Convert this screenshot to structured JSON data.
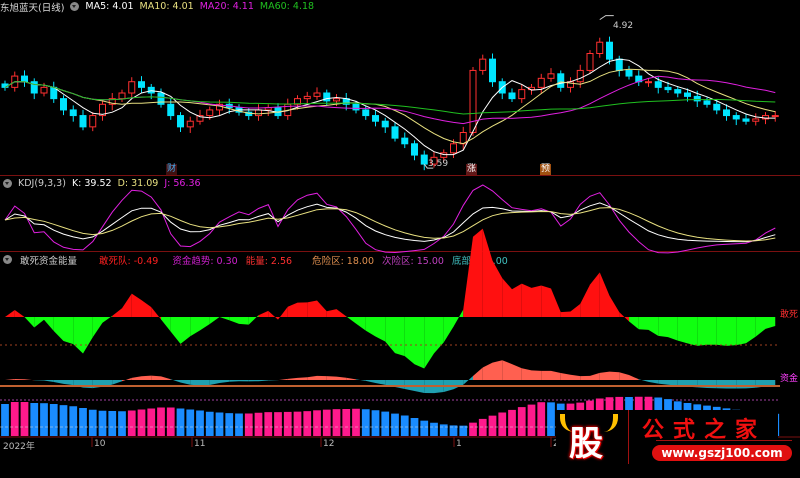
{
  "price_header": {
    "title": "东旭蓝天(日线)",
    "ma5": "MA5: 4.01",
    "ma10": "MA10: 4.01",
    "ma20": "MA20: 4.11",
    "ma60": "MA60: 4.18"
  },
  "kdj_header": {
    "title": "KDJ(9,3,3)",
    "k": "K: 39.52",
    "d": "D: 31.09",
    "j": "J: 56.36"
  },
  "gansi_header": {
    "title": "敢死资金能量",
    "gansi": "敢死队: -0.49",
    "trend": "资金趋势: 0.30",
    "energy": "能量: 2.56",
    "danger": "危险区: 18.00",
    "next_danger": "次险区: 15.00",
    "bottom": "底部区: 2.00"
  },
  "right_labels": {
    "gansi": "敢死",
    "fund": "资金"
  },
  "markers": {
    "high": "4.92",
    "low": "3.59",
    "cai": "财",
    "zhang": "涨",
    "yu": "预"
  },
  "x_axis": [
    "2022年",
    "10",
    "11",
    "12",
    "1",
    "2"
  ],
  "logo": {
    "char": "股",
    "name": "公式之家",
    "url": "www.gszj100.com"
  },
  "colors": {
    "up": "#ff3030",
    "down": "#00e5ff",
    "ma5": "#ffffff",
    "ma10": "#e8e080",
    "ma20": "#e020e0",
    "ma60": "#20c020",
    "gansi_pos": "#ff1010",
    "gansi_neg": "#10ff10",
    "hist_up": "#ff1a8c",
    "hist_down": "#1a8cff"
  },
  "chart_data": {
    "type": "candlestick",
    "ylim": [
      3.55,
      4.95
    ],
    "closes": [
      4.3,
      4.4,
      4.35,
      4.25,
      4.3,
      4.2,
      4.1,
      4.05,
      3.95,
      4.05,
      4.15,
      4.2,
      4.25,
      4.35,
      4.3,
      4.25,
      4.15,
      4.05,
      3.95,
      4.0,
      4.05,
      4.1,
      4.15,
      4.12,
      4.08,
      4.05,
      4.1,
      4.12,
      4.05,
      4.15,
      4.2,
      4.22,
      4.25,
      4.18,
      4.2,
      4.15,
      4.1,
      4.05,
      4.0,
      3.95,
      3.85,
      3.8,
      3.7,
      3.62,
      3.68,
      3.72,
      3.8,
      3.9,
      4.45,
      4.55,
      4.35,
      4.25,
      4.2,
      4.28,
      4.3,
      4.38,
      4.42,
      4.3,
      4.35,
      4.45,
      4.6,
      4.7,
      4.55,
      4.45,
      4.4,
      4.35,
      4.35,
      4.3,
      4.28,
      4.25,
      4.22,
      4.18,
      4.15,
      4.1,
      4.05,
      4.02,
      4.0,
      4.02,
      4.05,
      4.05
    ]
  }
}
